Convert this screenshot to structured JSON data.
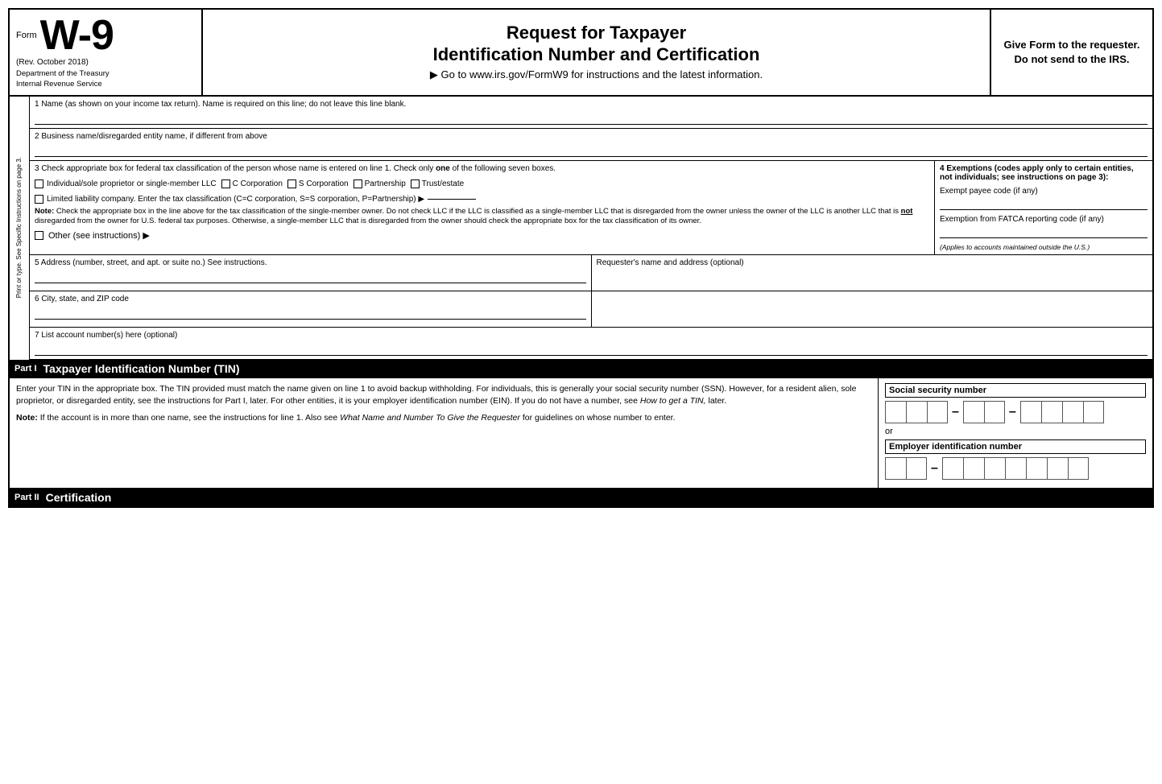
{
  "header": {
    "form_word": "Form",
    "form_number": "W-9",
    "rev_date": "(Rev. October 2018)",
    "dept_line1": "Department of the Treasury",
    "dept_line2": "Internal Revenue Service",
    "main_title_line1": "Request for Taxpayer",
    "main_title_line2": "Identification Number and Certification",
    "go_to": "▶ Go to www.irs.gov/FormW9 for instructions and the latest information.",
    "give_form": "Give Form to the requester. Do not send to the IRS."
  },
  "sidebar": {
    "text": "Print or type.  See Specific Instructions on page 3."
  },
  "fields": {
    "field1_label": "1  Name (as shown on your income tax return). Name is required on this line; do not leave this line blank.",
    "field2_label": "2  Business name/disregarded entity name, if different from above",
    "field3_label": "3  Check appropriate box for federal tax classification of the person whose name is entered on line 1. Check only",
    "field3_label2": "one",
    "field3_label3": "of the following seven boxes.",
    "checkbox_individual": "Individual/sole proprietor or single-member LLC",
    "checkbox_c_corp": "C Corporation",
    "checkbox_s_corp": "S Corporation",
    "checkbox_partnership": "Partnership",
    "checkbox_trust": "Trust/estate",
    "checkbox_llc_label": "Limited liability company. Enter the tax classification (C=C corporation, S=S corporation, P=Partnership) ▶",
    "note_bold": "Note:",
    "note_text": " Check the appropriate box in the line above for the tax classification of the single-member owner. Do not check LLC if the LLC is classified as a single-member LLC that is disregarded from the owner unless the owner of the LLC is another LLC that is",
    "not_bold": "not",
    "note_text2": " disregarded from the owner for U.S. federal tax purposes. Otherwise, a single-member LLC that is disregarded from the owner should check the appropriate box for the tax classification of its owner.",
    "checkbox_other": "Other (see instructions) ▶",
    "field4_label": "4  Exemptions (codes apply only to certain entities, not individuals; see instructions on page 3):",
    "exempt_payee_label": "Exempt payee code (if any)",
    "fatca_label": "Exemption from FATCA reporting code (if any)",
    "applies_note": "(Applies to accounts maintained outside the U.S.)",
    "field5_label": "5  Address (number, street, and apt. or suite no.) See instructions.",
    "field5_right": "Requester's name and address (optional)",
    "field6_label": "6  City, state, and ZIP code",
    "field7_label": "7  List account number(s) here (optional)"
  },
  "part1": {
    "label": "Part I",
    "title": "Taxpayer Identification Number (TIN)",
    "body_text": "Enter your TIN in the appropriate box. The TIN provided must match the name given on line 1 to avoid backup withholding. For individuals, this is generally your social security number (SSN). However, for a resident alien, sole proprietor, or disregarded entity, see the instructions for Part I, later. For other entities, it is your employer identification number (EIN). If you do not have a number, see",
    "body_italic": "How to get a TIN,",
    "body_text2": " later.",
    "note_label": "Note:",
    "note_text": " If the account is in more than one name, see the instructions for line 1. Also see",
    "note_italic": " What Name and Number To Give the Requester",
    "note_text2": " for guidelines on whose number to enter.",
    "ssn_label": "Social security number",
    "or_text": "or",
    "ein_label": "Employer identification number"
  },
  "part2": {
    "label": "Part II",
    "title": "Certification"
  }
}
